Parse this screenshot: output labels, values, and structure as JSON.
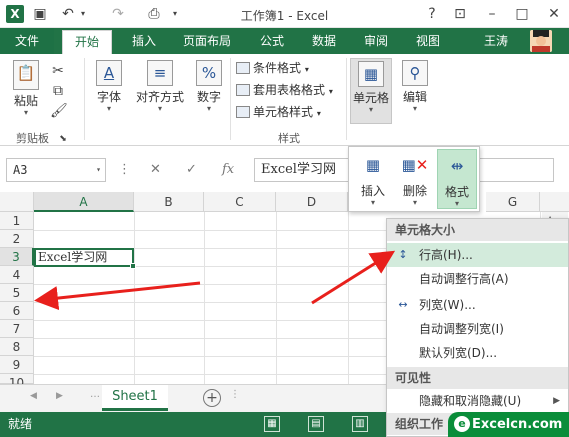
{
  "title": "工作簿1 - Excel",
  "tabs": [
    "文件",
    "开始",
    "插入",
    "页面布局",
    "公式",
    "数据",
    "审阅",
    "视图"
  ],
  "user": "王涛",
  "ribbon": {
    "paste": "粘贴",
    "clipboard_group": "剪贴板",
    "font": "字体",
    "align": "对齐方式",
    "number": "数字",
    "cond_format": "条件格式",
    "table_format": "套用表格格式",
    "cell_style": "单元格样式",
    "styles_group": "样式",
    "cells": "单元格",
    "edit": "编辑"
  },
  "formula_bar": {
    "name_box": "A3",
    "fx": "fx",
    "content": "Excel学习网"
  },
  "columns": [
    "A",
    "B",
    "C",
    "D",
    "G"
  ],
  "rows": [
    "1",
    "2",
    "3",
    "4",
    "5",
    "6",
    "7",
    "8",
    "9",
    "10"
  ],
  "cell_a3": "Excel学习网",
  "cells_dropdown": {
    "insert": "插入",
    "delete": "删除",
    "format": "格式"
  },
  "menu": {
    "header_size": "单元格大小",
    "row_height": "行高(H)...",
    "autofit_row": "自动调整行高(A)",
    "col_width": "列宽(W)...",
    "autofit_col": "自动调整列宽(I)",
    "default_width": "默认列宽(D)...",
    "header_visibility": "可见性",
    "hide_unhide": "隐藏和取消隐藏(U)",
    "header_organize": "组织工作"
  },
  "sheet_tab": "Sheet1",
  "status": "就绪",
  "watermark": "Excelcn.com",
  "colors": {
    "accent": "#217346",
    "arrow": "#e8201c"
  }
}
